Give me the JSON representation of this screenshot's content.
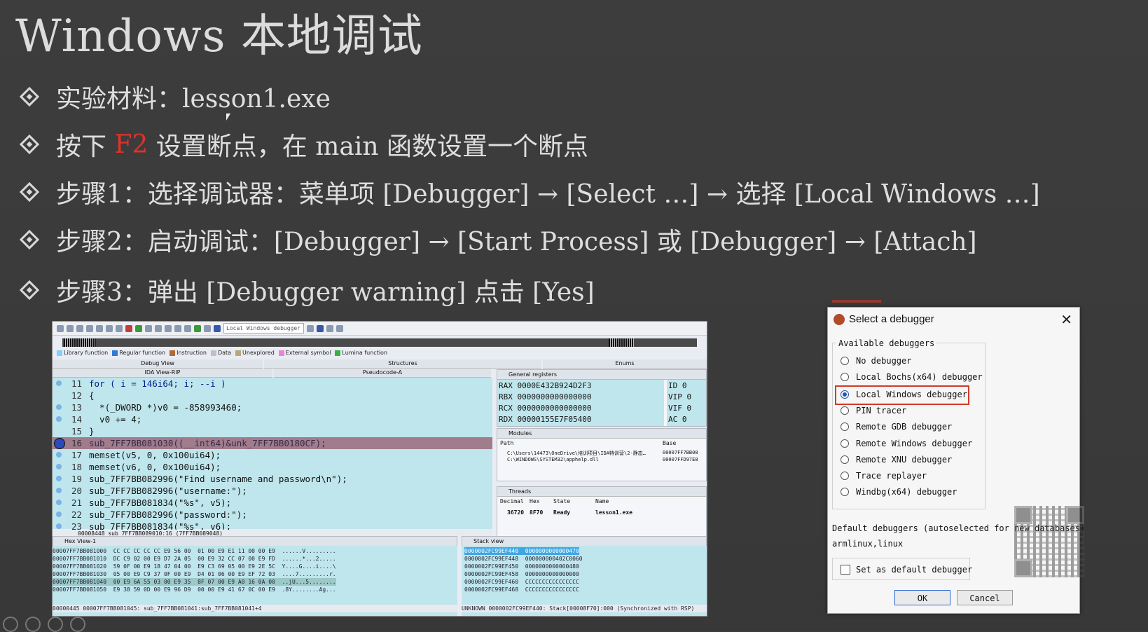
{
  "slide": {
    "title": "Windows 本地调试",
    "bullets": [
      {
        "pre": "实验材料：lesson1.exe",
        "red": "",
        "post": ""
      },
      {
        "pre": "按下 ",
        "red": "F2",
        "post": " 设置断点，在 main 函数设置一个断点"
      },
      {
        "pre": "步骤1：选择调试器：菜单项 [Debugger] → [Select …] → 选择 [Local Windows …]",
        "red": "",
        "post": ""
      },
      {
        "pre": "步骤2：启动调试：[Debugger] → [Start Process] 或 [Debugger] → [Attach]",
        "red": "",
        "post": ""
      },
      {
        "pre": "步骤3：弹出 [Debugger warning] 点击 [Yes]",
        "red": "",
        "post": ""
      }
    ],
    "red_color": "#e0322b"
  },
  "ida": {
    "debugger_combo": "Local Windows debugger",
    "legend": [
      {
        "label": "Library function",
        "color": "#7fd0ff"
      },
      {
        "label": "Regular function",
        "color": "#2e7ad6"
      },
      {
        "label": "Instruction",
        "color": "#b06a3a"
      },
      {
        "label": "Data",
        "color": "#c0c0c0"
      },
      {
        "label": "Unexplored",
        "color": "#b8a878"
      },
      {
        "label": "External symbol",
        "color": "#f080e0"
      },
      {
        "label": "Lumina function",
        "color": "#3ab040"
      }
    ],
    "tabs": {
      "debug_view": "Debug View",
      "structures": "Structures",
      "enums": "Enums",
      "ida_view": "IDA View-RIP",
      "pseudocode": "Pseudocode-A"
    },
    "code_lines": [
      {
        "n": "11",
        "text": "for ( i = 146i64; i; --i )"
      },
      {
        "n": "12",
        "text": "{"
      },
      {
        "n": "13",
        "text": "  *(_DWORD *)v0 = -858993460;"
      },
      {
        "n": "14",
        "text": "  v0 += 4;"
      },
      {
        "n": "15",
        "text": "}"
      },
      {
        "n": "16",
        "text": "sub_7FF7BB081030((__int64)&unk_7FF7BB0180CF);"
      },
      {
        "n": "17",
        "text": "memset(v5, 0, 0x100ui64);"
      },
      {
        "n": "18",
        "text": "memset(v6, 0, 0x100ui64);"
      },
      {
        "n": "19",
        "text": "sub_7FF7BB082996(\"Find username and password\\n\");"
      },
      {
        "n": "20",
        "text": "sub_7FF7BB082996(\"username:\");"
      },
      {
        "n": "21",
        "text": "sub_7FF7BB081834(\"%s\", v5);"
      },
      {
        "n": "22",
        "text": "sub_7FF7BB082996(\"password:\");"
      },
      {
        "n": "23",
        "text": "sub_7FF7BB081834(\"%s\", v6);"
      }
    ],
    "code_status": "00008448 sub_7FF7BB089010:16 (7FF7BB089048)",
    "general_registers": {
      "title": "General registers",
      "regs": [
        "RAX 0000E432B924D2F3",
        "RBX 0000000000000000",
        "RCX 0000000000000000",
        "RDX 00000155E7F05400"
      ],
      "flags": [
        "ID  0",
        "VIP 0",
        "VIF 0",
        "AC  0"
      ]
    },
    "modules": {
      "title": "Modules",
      "col_path": "Path",
      "col_base": "Base",
      "rows": [
        {
          "path": "C:\\Users\\14473\\OneDrive\\培训项目\\IDA特训营\\2-静态…",
          "base": "00007FF7BB08"
        },
        {
          "path": "C:\\WINDOWS\\SYSTEM32\\apphelp.dll",
          "base": "00007FFD97E8"
        }
      ]
    },
    "threads": {
      "title": "Threads",
      "headers": [
        "Decimal",
        "Hex",
        "State",
        "Name"
      ],
      "row": [
        "36720",
        "8F70",
        "Ready",
        "lesson1.exe"
      ]
    },
    "hex_view": {
      "title": "Hex View-1",
      "lines": [
        "00007FF7BB081000  CC CC CC CC CC E9 56 00  01 00 E9 E1 11 00 00 E9  ......V.........",
        "00007FF7BB081010  DC C9 02 00 E9 D7 2A 05  00 E9 32 CC 07 00 E9 FD  ......*...2.....",
        "00007FF7BB081020  59 0F 00 E9 18 47 04 00  E9 C3 69 05 00 E9 2E 5C  Y....G....i....\\",
        "00007FF7BB081030  05 00 E9 C9 37 0F 00 E9  D4 01 06 00 E9 EF 72 03  ....7.........r.",
        "00007FF7BB081040  00 E9 6A 55 03 00 E9 35  8F 07 00 E9 A0 16 0A 00  ..jU...5........",
        "00007FF7BB081050  E9 38 59 0D 00 E9 96 D9  00 00 E9 41 67 0C 00 E9  .8Y........Ag..."
      ],
      "status": "00000445 00007FF7BB081045: sub_7FF7BB081041:sub_7FF7BB081041+4"
    },
    "stack_view": {
      "title": "Stack view",
      "lines": [
        "0000002FC99EF440  0000000000000470",
        "0000002FC99EF448  000000000402C0060",
        "0000002FC99EF450  0000000000000480",
        "0000002FC99EF458  0000000000000000",
        "0000002FC99EF460  CCCCCCCCCCCCCCCC",
        "0000002FC99EF468  CCCCCCCCCCCCCCCC"
      ],
      "status": "UNKNOWN 0000002FC99EF440: Stack[00008F70]:000 (Synchronized with RSP)"
    }
  },
  "dialog": {
    "title": "Select a debugger",
    "close": "✕",
    "group_label": "Available debuggers",
    "options": [
      {
        "label": "No debugger",
        "selected": false
      },
      {
        "label": "Local Bochs(x64) debugger",
        "selected": false
      },
      {
        "label": "Local Windows debugger",
        "selected": true
      },
      {
        "label": "PIN tracer",
        "selected": false
      },
      {
        "label": "Remote GDB debugger",
        "selected": false
      },
      {
        "label": "Remote Windows debugger",
        "selected": false
      },
      {
        "label": "Remote XNU debugger",
        "selected": false
      },
      {
        "label": "Trace replayer",
        "selected": false
      },
      {
        "label": "Windbg(x64) debugger",
        "selected": false
      }
    ],
    "defaults_text": "Default debuggers (autoselected for new databases)",
    "defaults_value": "armlinux,linux",
    "set_default_label": "Set as default debugger",
    "ok_label": "OK",
    "cancel_label": "Cancel"
  }
}
